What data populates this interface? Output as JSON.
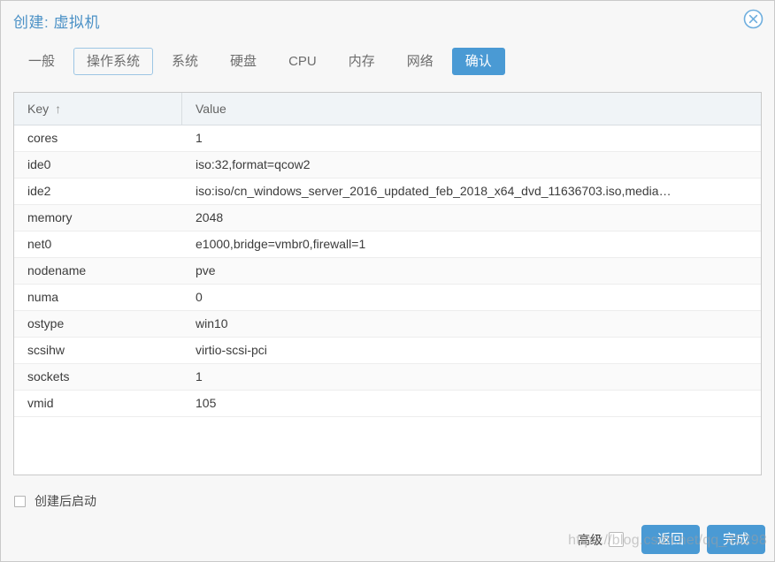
{
  "window": {
    "title": "创建: 虚拟机",
    "close_icon": "close-circle-icon"
  },
  "tabs": [
    {
      "label": "一般",
      "state": "normal"
    },
    {
      "label": "操作系统",
      "state": "focused"
    },
    {
      "label": "系统",
      "state": "normal"
    },
    {
      "label": "硬盘",
      "state": "normal"
    },
    {
      "label": "CPU",
      "state": "normal"
    },
    {
      "label": "内存",
      "state": "normal"
    },
    {
      "label": "网络",
      "state": "normal"
    },
    {
      "label": "确认",
      "state": "active"
    }
  ],
  "grid": {
    "columns": [
      {
        "label": "Key",
        "sort_indicator": "↑"
      },
      {
        "label": "Value",
        "sort_indicator": ""
      }
    ],
    "rows": [
      {
        "key": "cores",
        "value": "1"
      },
      {
        "key": "ide0",
        "value": "iso:32,format=qcow2"
      },
      {
        "key": "ide2",
        "value": "iso:iso/cn_windows_server_2016_updated_feb_2018_x64_dvd_11636703.iso,media…"
      },
      {
        "key": "memory",
        "value": "2048"
      },
      {
        "key": "net0",
        "value": "e1000,bridge=vmbr0,firewall=1"
      },
      {
        "key": "nodename",
        "value": "pve"
      },
      {
        "key": "numa",
        "value": "0"
      },
      {
        "key": "ostype",
        "value": "win10"
      },
      {
        "key": "scsihw",
        "value": "virtio-scsi-pci"
      },
      {
        "key": "sockets",
        "value": "1"
      },
      {
        "key": "vmid",
        "value": "105"
      }
    ]
  },
  "options": {
    "start_after_create_label": "创建后启动",
    "start_after_create_checked": false,
    "advanced_label": "高级",
    "advanced_checked": false
  },
  "footer": {
    "back_label": "返回",
    "finish_label": "完成"
  },
  "watermark": {
    "text": "https://blog.csdn.net/qq_45298"
  },
  "colors": {
    "accent": "#4a9ad4",
    "title": "#4b91c6",
    "header_bg": "#f0f4f7",
    "window_bg": "#f7f7f7",
    "row_alt": "#fafafa"
  }
}
